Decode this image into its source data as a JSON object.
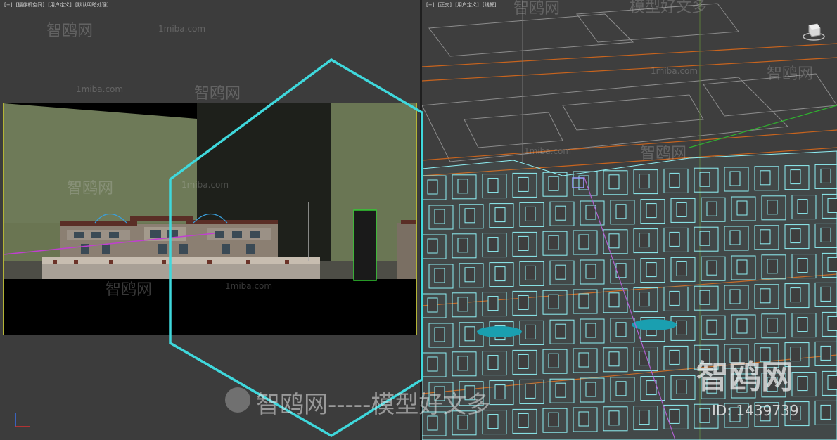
{
  "viewports": {
    "left": {
      "labels": [
        "[+]",
        "[摄像机空间]",
        "[用户定义]",
        "[默认明暗处理]"
      ]
    },
    "right": {
      "labels": [
        "[+]",
        "[正交]",
        "[用户定义]",
        "[线框]"
      ]
    }
  },
  "watermarks": {
    "brand_cn": "智鸥网",
    "domain": "1miba.com",
    "dash_line": "- - - - -",
    "tagline": "智鸥网-----模型好文多",
    "tagline_partial": "模型好文多",
    "big_logo_text": "智鸥网",
    "id_text": "ID: 1439739"
  },
  "colors": {
    "viewport_bg": "#3c3c3c",
    "frame_border": "#b4b436",
    "selection_hex": "#3fd8dc",
    "wire_cyan": "#8ff0f4",
    "wire_orange": "#c8641e",
    "grid_grey": "#8c8c8c"
  },
  "icons": {
    "viewcube": "viewcube-icon",
    "axis": "axis-gizmo-icon",
    "logo": "bird-logo-icon"
  }
}
